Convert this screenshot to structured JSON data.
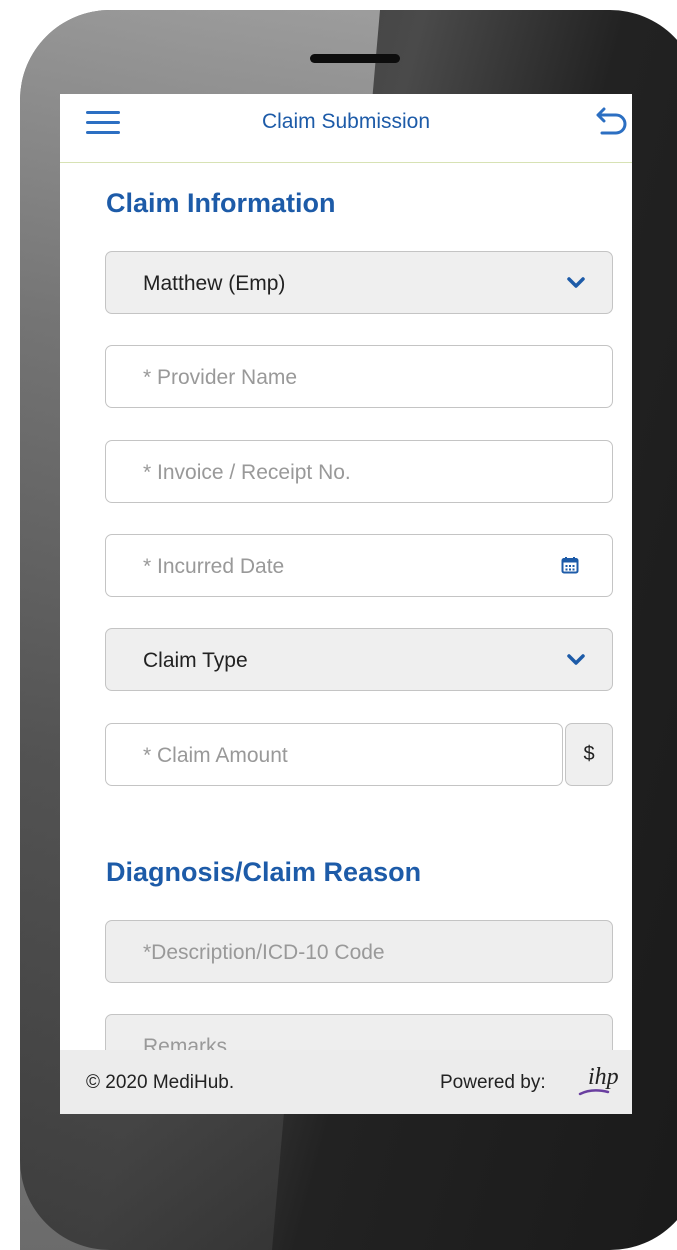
{
  "header": {
    "title": "Claim Submission",
    "menu_icon": "hamburger-menu-icon",
    "back_icon": "back-arrow-icon"
  },
  "claim_information": {
    "title": "Claim Information",
    "member_select": {
      "value": "Matthew (Emp)"
    },
    "provider_name": {
      "placeholder": "* Provider Name"
    },
    "invoice_no": {
      "placeholder": "* Invoice / Receipt No."
    },
    "incurred_date": {
      "placeholder": "* Incurred Date",
      "icon": "calendar-icon"
    },
    "claim_type": {
      "value": "Claim Type"
    },
    "claim_amount": {
      "placeholder": "* Claim Amount",
      "currency": "$"
    }
  },
  "diagnosis": {
    "title": "Diagnosis/Claim Reason",
    "description": {
      "placeholder": "*Description/ICD-10 Code"
    },
    "remarks": {
      "placeholder": "Remarks"
    }
  },
  "footer": {
    "copyright": "© 2020 MediHub.",
    "powered_by": "Powered by:",
    "logo_text": "ihp"
  },
  "colors": {
    "accent": "#1d5ba8",
    "header_border": "#d7e2b4",
    "field_bg": "#efefef",
    "footer_bg": "#ececec"
  }
}
